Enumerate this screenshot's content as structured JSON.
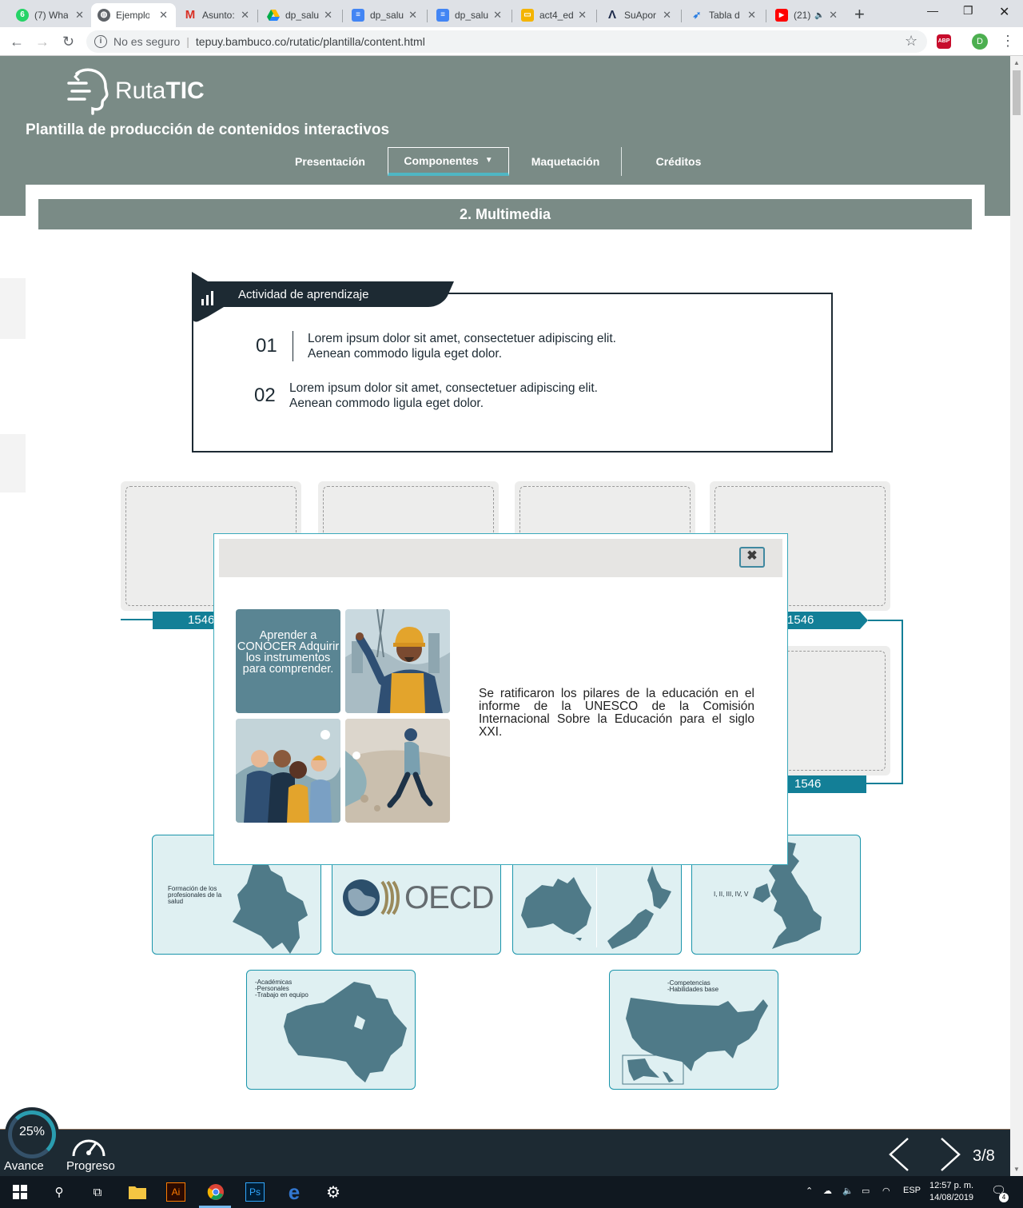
{
  "browser": {
    "tabs": [
      {
        "title": "(7) Wha",
        "icon": "whatsapp-icon",
        "color": "#25d366",
        "active": false
      },
      {
        "title": "Ejemplo",
        "icon": "globe-icon",
        "color": "#5f6368",
        "active": true
      },
      {
        "title": "Asunto:",
        "icon": "gmail-icon",
        "color": "#d93025",
        "active": false
      },
      {
        "title": "dp_salu",
        "icon": "drive-icon",
        "color": "#1fa463",
        "active": false
      },
      {
        "title": "dp_salu",
        "icon": "docs-icon",
        "color": "#4285f4",
        "active": false
      },
      {
        "title": "dp_salu",
        "icon": "docs-icon",
        "color": "#4285f4",
        "active": false
      },
      {
        "title": "act4_ed",
        "icon": "slides-icon",
        "color": "#f4b400",
        "active": false
      },
      {
        "title": "SuApor",
        "icon": "a-logo-icon",
        "color": "#1d2a4a",
        "active": false
      },
      {
        "title": "Tabla d",
        "icon": "chart-icon",
        "color": "#2a7de1",
        "active": false
      },
      {
        "title": "(21)",
        "icon": "youtube-icon",
        "color": "#ff0000",
        "active": false
      }
    ],
    "security_label": "No es seguro",
    "url": "tepuy.bambuco.co/rutatic/plantilla/content.html",
    "profile_initial": "D",
    "adblock_label": "ABP"
  },
  "header": {
    "logo_light": "Ruta",
    "logo_bold": "TIC",
    "subtitle": "Plantilla de producción de contenidos interactivos",
    "nav": [
      "Presentación",
      "Componentes",
      "Maquetación",
      "Créditos"
    ],
    "active_nav": "Componentes"
  },
  "section": {
    "title": "2. Multimedia"
  },
  "activity": {
    "label": "Actividad de aprendizaje",
    "items": [
      {
        "number": "01",
        "text": "Lorem ipsum dolor sit amet, consectetuer adipiscing elit. Aenean commodo ligula eget dolor."
      },
      {
        "number": "02",
        "text": "Lorem ipsum dolor sit amet, consectetuer adipiscing elit. Aenean commodo ligula eget dolor."
      }
    ]
  },
  "timeline": {
    "tags": [
      "1546",
      "1546",
      "1546"
    ]
  },
  "map_cards": [
    {
      "map": "colombia",
      "caption": "Formación de los profesionales de la salud"
    },
    {
      "map": "oecd",
      "caption": "OECD"
    },
    {
      "map": "australia-nz",
      "caption": ""
    },
    {
      "map": "uk",
      "caption": "I, II, III, IV, V"
    },
    {
      "map": "canada",
      "caption_lines": [
        "-Académicas",
        "-Personales",
        "-Trabajo en equipo"
      ]
    },
    {
      "map": "usa",
      "caption_lines": [
        "-Competencias",
        "-Habilidades base"
      ]
    }
  ],
  "modal": {
    "close_label": "✖",
    "tile_text": "Aprender a CONOCER Adquirir los instrumentos para comprender.",
    "body_text": "Se ratificaron los pilares de la educación en el informe de la UNESCO de la Comisión Internacional Sobre la Educación para el siglo XXI."
  },
  "progress": {
    "percent_label": "25%",
    "percent_value": 0.25,
    "avance_label": "Avance",
    "progreso_label": "Progreso",
    "page": "3/8"
  },
  "taskbar": {
    "language": "ESP",
    "time": "12:57 p. m.",
    "date": "14/08/2019",
    "notifications": "4"
  },
  "colors": {
    "header": "#7a8b86",
    "dark": "#1d2a33",
    "accent": "#137f97",
    "map_fill": "#4f7a88",
    "map_bg": "#dff0f2"
  }
}
